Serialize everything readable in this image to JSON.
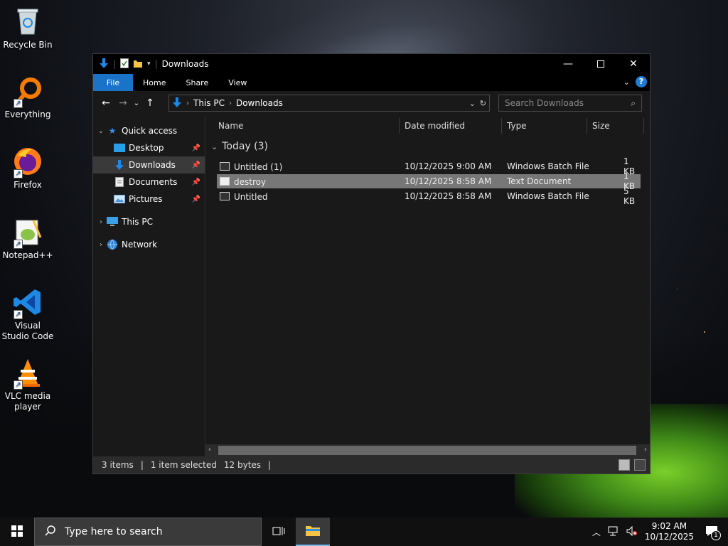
{
  "desktop": {
    "icons": [
      {
        "label": "Recycle Bin",
        "icon": "recycle-bin-icon"
      },
      {
        "label": "Everything",
        "icon": "everything-search-icon"
      },
      {
        "label": "Firefox",
        "icon": "firefox-icon"
      },
      {
        "label": "Notepad++",
        "icon": "notepad-plus-plus-icon"
      },
      {
        "label": "Visual Studio Code",
        "icon": "vscode-icon"
      },
      {
        "label": "VLC media player",
        "icon": "vlc-icon"
      }
    ]
  },
  "window": {
    "title": "Downloads",
    "ribbon_tabs": [
      "File",
      "Home",
      "Share",
      "View"
    ],
    "help_label": "?",
    "address": {
      "crumbs": [
        "This PC",
        "Downloads"
      ]
    },
    "search": {
      "placeholder": "Search Downloads"
    },
    "nav": {
      "quick_access": "Quick access",
      "items": [
        {
          "label": "Desktop",
          "pinned": true
        },
        {
          "label": "Downloads",
          "pinned": true,
          "selected": true
        },
        {
          "label": "Documents",
          "pinned": true
        },
        {
          "label": "Pictures",
          "pinned": true
        }
      ],
      "this_pc": "This PC",
      "network": "Network"
    },
    "columns": {
      "name": "Name",
      "date": "Date modified",
      "type": "Type",
      "size": "Size"
    },
    "group_label": "Today (3)",
    "files": [
      {
        "name": "Untitled (1)",
        "date": "10/12/2025 9:00 AM",
        "type": "Windows Batch File",
        "size": "1 KB",
        "selected": false
      },
      {
        "name": "destroy",
        "date": "10/12/2025 8:58 AM",
        "type": "Text Document",
        "size": "1 KB",
        "selected": true
      },
      {
        "name": "Untitled",
        "date": "10/12/2025 8:58 AM",
        "type": "Windows Batch File",
        "size": "5 KB",
        "selected": false
      }
    ],
    "status": {
      "count": "3 items",
      "selection": "1 item selected",
      "size": "12 bytes"
    }
  },
  "taskbar": {
    "search_placeholder": "Type here to search",
    "time": "9:02 AM",
    "date": "10/12/2025",
    "notification_count": "1"
  },
  "colors": {
    "accent": "#1a73c7",
    "window_bg": "#191919",
    "selection": "#777777"
  }
}
